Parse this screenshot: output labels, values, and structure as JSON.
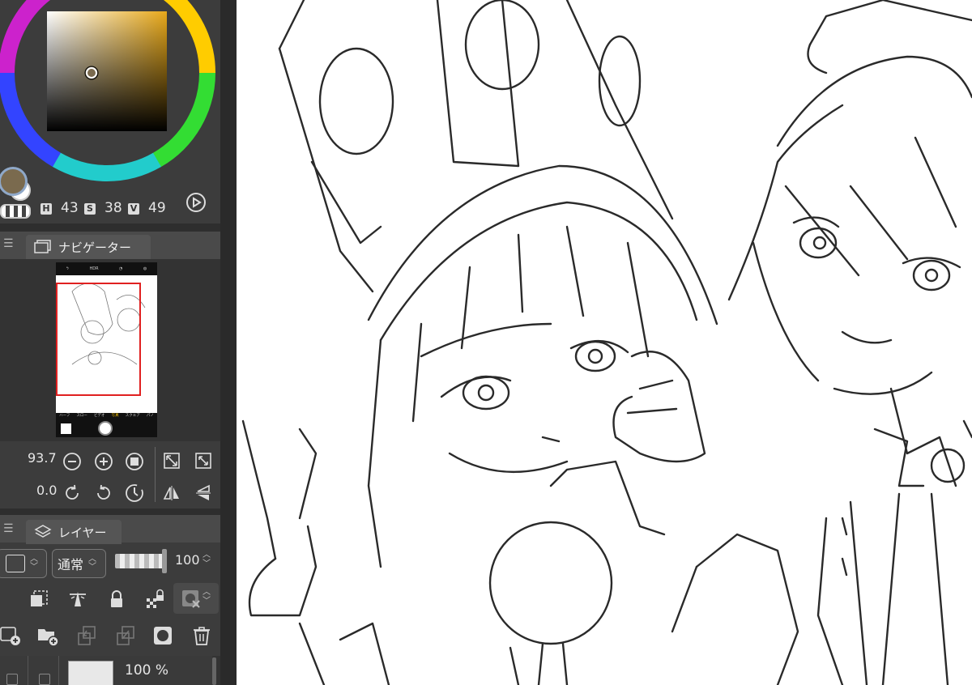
{
  "color": {
    "h": "43",
    "s": "38",
    "v": "49",
    "labels": {
      "h": "H",
      "s": "S",
      "v": "V"
    },
    "main_color": "#7a6a4e",
    "square_hue": "#e7a81a"
  },
  "navigator": {
    "tab_label": "ナビゲーター",
    "zoom": "93.7",
    "rotation": "0.0",
    "thumb_top_labels": [
      "HDR"
    ],
    "thumb_bottom_labels": [
      "ハーフ",
      "スロー",
      "ビデオ",
      "写真",
      "スクエア",
      "パノ"
    ]
  },
  "layers": {
    "tab_label": "レイヤー",
    "blend_mode": "通常",
    "opacity": "100",
    "row_opacity": "100 %"
  }
}
